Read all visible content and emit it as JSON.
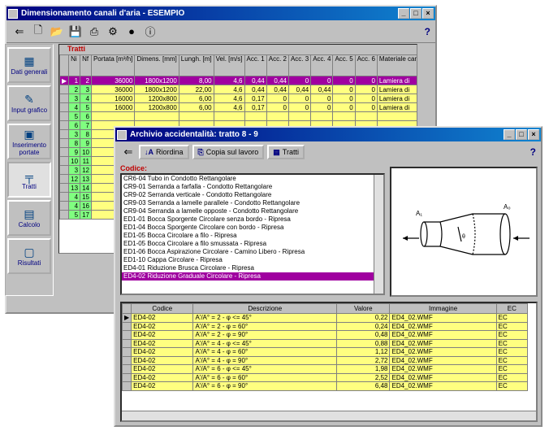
{
  "main_window": {
    "title": "Dimensionamento canali d'aria - ESEMPIO",
    "help": "?",
    "toolbar_icons": [
      "exit-icon",
      "new-icon",
      "open-icon",
      "save-icon",
      "print-icon",
      "tools-icon",
      "globe-icon",
      "info-icon"
    ]
  },
  "sidebar": [
    {
      "label": "Dati generali",
      "icon": "data-icon"
    },
    {
      "label": "Input grafico",
      "icon": "graphic-icon"
    },
    {
      "label": "Inserimento portate",
      "icon": "flow-icon"
    },
    {
      "label": "Tratti",
      "icon": "sections-icon"
    },
    {
      "label": "Calcolo",
      "icon": "calc-icon"
    },
    {
      "label": "Risultati",
      "icon": "results-icon"
    }
  ],
  "tratti": {
    "title": "Tratti",
    "columns": [
      "Ni",
      "Nf",
      "Portata [m³/h]",
      "Dimens. [mm]",
      "Lungh. [m]",
      "Vel. [m/s]",
      "Acc. 1",
      "Acc. 2",
      "Acc. 3",
      "Acc. 4",
      "Acc. 5",
      "Acc. 6",
      "Materiale canale"
    ],
    "rows": [
      [
        "1",
        "2",
        "36000",
        "1800x1200",
        "8,00",
        "4,6",
        "0,44",
        "0,44",
        "0",
        "0",
        "0",
        "0",
        "Lamiera di"
      ],
      [
        "2",
        "3",
        "36000",
        "1800x1200",
        "22,00",
        "4,6",
        "0,44",
        "0,44",
        "0,44",
        "0,44",
        "0",
        "0",
        "Lamiera di"
      ],
      [
        "3",
        "4",
        "16000",
        "1200x800",
        "6,00",
        "4,6",
        "0,17",
        "0",
        "0",
        "0",
        "0",
        "0",
        "Lamiera di"
      ],
      [
        "4",
        "5",
        "16000",
        "1200x800",
        "6,00",
        "4,6",
        "0,17",
        "0",
        "0",
        "0",
        "0",
        "0",
        "Lamiera di"
      ],
      [
        "5",
        "6",
        "",
        "",
        "",
        "",
        "",
        "",
        "",
        "",
        "",
        "",
        ""
      ],
      [
        "6",
        "7",
        "",
        "",
        "",
        "",
        "",
        "",
        "",
        "",
        "",
        "",
        ""
      ],
      [
        "3",
        "8",
        "",
        "",
        "",
        "",
        "",
        "",
        "",
        "",
        "",
        "",
        ""
      ],
      [
        "8",
        "9",
        "",
        "",
        "",
        "",
        "",
        "",
        "",
        "",
        "",
        "",
        ""
      ],
      [
        "9",
        "10",
        "",
        "",
        "",
        "",
        "",
        "",
        "",
        "",
        "",
        "",
        ""
      ],
      [
        "10",
        "11",
        "",
        "",
        "",
        "",
        "",
        "",
        "",
        "",
        "",
        "",
        ""
      ],
      [
        "3",
        "12",
        "",
        "",
        "",
        "",
        "",
        "",
        "",
        "",
        "",
        "",
        ""
      ],
      [
        "12",
        "13",
        "",
        "",
        "",
        "",
        "",
        "",
        "",
        "",
        "",
        "",
        ""
      ],
      [
        "13",
        "14",
        "",
        "",
        "",
        "",
        "",
        "",
        "",
        "",
        "",
        "",
        ""
      ],
      [
        "4",
        "15",
        "",
        "",
        "",
        "",
        "",
        "",
        "",
        "",
        "",
        "",
        ""
      ],
      [
        "4",
        "16",
        "",
        "",
        "",
        "",
        "",
        "",
        "",
        "",
        "",
        "",
        ""
      ],
      [
        "5",
        "17",
        "",
        "",
        "",
        "",
        "",
        "",
        "",
        "",
        "",
        "",
        ""
      ]
    ]
  },
  "archivio": {
    "title": "Archivio accidentalità: tratto 8 - 9",
    "help": "?",
    "buttons": [
      "Riordina",
      "Copia sul lavoro",
      "Tratti"
    ],
    "codice_label": "Codice:",
    "list_items": [
      "CR6-04 Tubo in Condotto Rettangolare",
      "CR9-01 Serranda a farfalla - Condotto Rettangolare",
      "CR9-02 Serranda verticale - Condotto Rettangolare",
      "CR9-03 Serranda a lamelle parallele - Condotto Rettangolare",
      "CR9-04 Serranda a lamelle opposte - Condotto Rettangolare",
      "ED1-01 Bocca Sporgente Circolare senza bordo - Ripresa",
      "ED1-04 Bocca Sporgente Circolare con bordo - Ripresa",
      "ED1-05 Bocca Circolare a filo - Ripresa",
      "ED1-05 Bocca Circolare a filo smussata - Ripresa",
      "ED1-06 Bocca Aspirazione Circolare - Camino Libero - Ripresa",
      "ED1-10 Cappa Circolare - Ripresa",
      "ED4-01 Riduzione Brusca Circolare - Ripresa",
      "ED4-02 Riduzione Graduale Circolare - Ripresa"
    ],
    "diagram_labels": {
      "a1": "A₁",
      "a0": "A₀",
      "angle": "θ"
    },
    "detail_columns": [
      "Codice",
      "Descrizione",
      "Valore",
      "Immagine",
      "EC"
    ],
    "detail_rows": [
      [
        "ED4-02",
        "A'/A° = 2 - φ <= 45°",
        "0,22",
        "ED4_02.WMF",
        "EC"
      ],
      [
        "ED4-02",
        "A'/A° = 2 - φ = 60°",
        "0,24",
        "ED4_02.WMF",
        "EC"
      ],
      [
        "ED4-02",
        "A'/A° = 2 - φ = 90°",
        "0,48",
        "ED4_02.WMF",
        "EC"
      ],
      [
        "ED4-02",
        "A'/A° = 4 - φ <= 45°",
        "0,88",
        "ED4_02.WMF",
        "EC"
      ],
      [
        "ED4-02",
        "A'/A° = 4 - φ = 60°",
        "1,12",
        "ED4_02.WMF",
        "EC"
      ],
      [
        "ED4-02",
        "A'/A° = 4 - φ = 90°",
        "2,72",
        "ED4_02.WMF",
        "EC"
      ],
      [
        "ED4-02",
        "A'/A° = 6 - φ <= 45°",
        "1,98",
        "ED4_02.WMF",
        "EC"
      ],
      [
        "ED4-02",
        "A'/A° = 6 - φ = 60°",
        "2,52",
        "ED4_02.WMF",
        "EC"
      ],
      [
        "ED4-02",
        "A'/A° = 6 - φ = 90°",
        "6,48",
        "ED4_02.WMF",
        "EC"
      ]
    ]
  }
}
